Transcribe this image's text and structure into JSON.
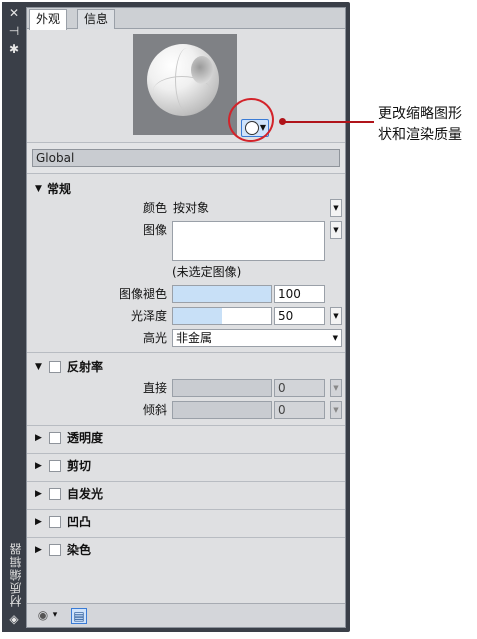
{
  "sidebar": {
    "close_glyph": "✕",
    "pin_glyph": "⊣",
    "settings_glyph": "✱",
    "title": "材质编辑器",
    "bottom_glyph": "◈"
  },
  "tabs": [
    {
      "label": "外观",
      "active": true
    },
    {
      "label": "信息",
      "active": false
    }
  ],
  "preview": {
    "quality_button_arrow": "▼"
  },
  "callout": {
    "text": "更改缩略图形\n状和渲染质量",
    "color": "#d3232a"
  },
  "material_name": "Global",
  "general": {
    "title": "常规",
    "collapse_glyph": "▼",
    "color_label": "颜色",
    "color_value": "按对象",
    "image_label": "图像",
    "no_image_text": "(未选定图像)",
    "image_fade_label": "图像褪色",
    "image_fade_value": "100",
    "image_fade_fraction": 1.0,
    "glossiness_label": "光泽度",
    "glossiness_value": "50",
    "glossiness_fraction": 0.5,
    "highlight_label": "高光",
    "highlight_value": "非金属"
  },
  "reflectivity": {
    "title": "反射率",
    "collapse_glyph": "▼",
    "direct_label": "直接",
    "direct_value": "0",
    "oblique_label": "倾斜",
    "oblique_value": "0"
  },
  "collapsed_sections": [
    {
      "title": "透明度",
      "glyph": "▶"
    },
    {
      "title": "剪切",
      "glyph": "▶"
    },
    {
      "title": "自发光",
      "glyph": "▶"
    },
    {
      "title": "凹凸",
      "glyph": "▶"
    },
    {
      "title": "染色",
      "glyph": "▶"
    }
  ],
  "dropdown_glyph": "▼",
  "bottom_bar": {
    "material_glyph": "◉",
    "arrow_glyph": "▾",
    "browser_glyph": "▤"
  }
}
